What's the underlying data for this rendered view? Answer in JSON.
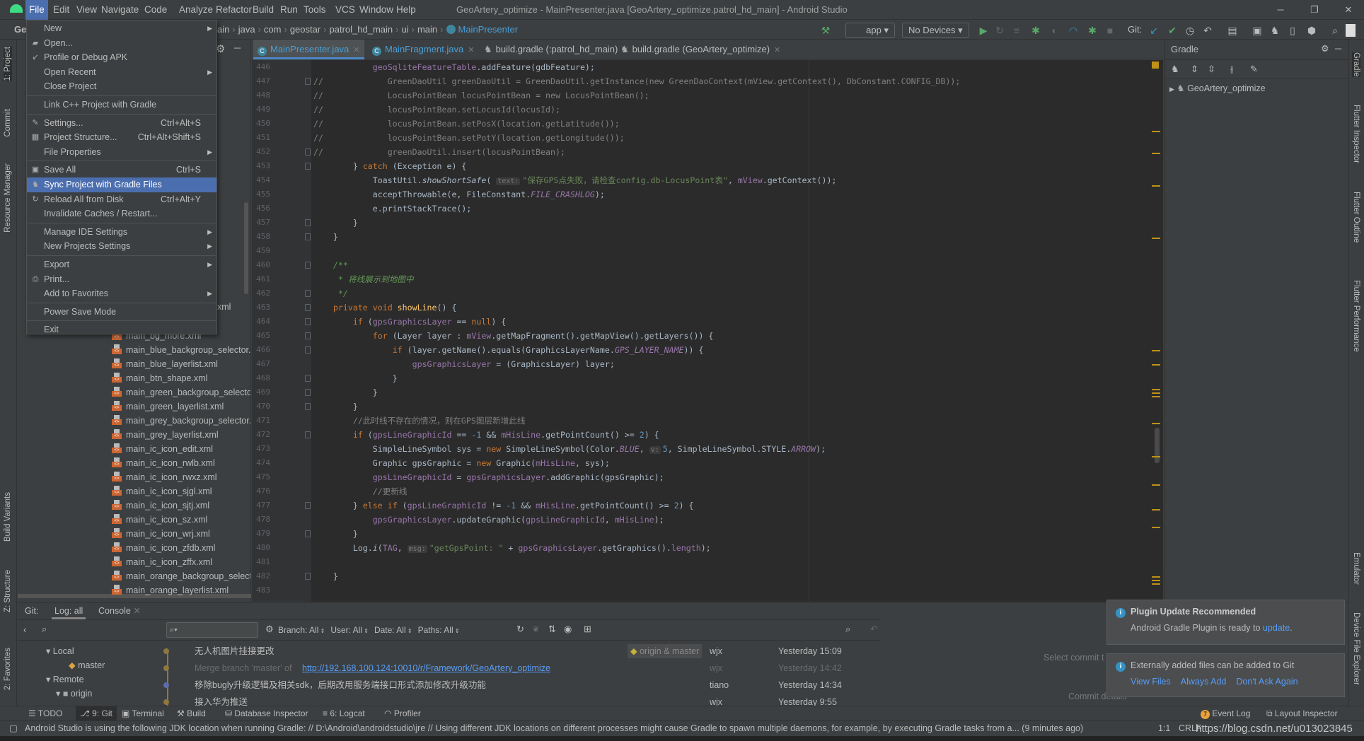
{
  "title": "GeoArtery_optimize - MainPresenter.java [GeoArtery_optimize.patrol_hd_main] - Android Studio",
  "menubar": [
    "File",
    "Edit",
    "View",
    "Navigate",
    "Code",
    "Analyze",
    "Refactor",
    "Build",
    "Run",
    "Tools",
    "VCS",
    "Window",
    "Help"
  ],
  "breadcrumb": {
    "project": "Ge",
    "items": [
      "ain",
      "java",
      "com",
      "geostar",
      "patrol_hd_main",
      "ui",
      "main"
    ],
    "current": "MainPresenter"
  },
  "toolbar": {
    "run_config": "app",
    "device": "No Devices",
    "git_label": "Git:"
  },
  "file_menu": [
    {
      "label": "New",
      "submenu": true,
      "icon": ""
    },
    {
      "label": "Open...",
      "icon": "folder-icon"
    },
    {
      "label": "Profile or Debug APK",
      "icon": "profile-icon"
    },
    {
      "label": "Open Recent",
      "submenu": true
    },
    {
      "label": "Close Project",
      "sep_after": true
    },
    {
      "label": "Link C++ Project with Gradle",
      "sep_after": true
    },
    {
      "label": "Settings...",
      "shortcut": "Ctrl+Alt+S",
      "icon": "wrench-icon"
    },
    {
      "label": "Project Structure...",
      "shortcut": "Ctrl+Alt+Shift+S",
      "icon": "project-structure-icon"
    },
    {
      "label": "File Properties",
      "submenu": true,
      "sep_after": true
    },
    {
      "label": "Save All",
      "shortcut": "Ctrl+S",
      "icon": "save-icon"
    },
    {
      "label": "Sync Project with Gradle Files",
      "icon": "gradle-sync-icon",
      "selected": true
    },
    {
      "label": "Reload All from Disk",
      "shortcut": "Ctrl+Alt+Y",
      "icon": "reload-icon"
    },
    {
      "label": "Invalidate Caches / Restart...",
      "sep_after": true
    },
    {
      "label": "Manage IDE Settings",
      "submenu": true
    },
    {
      "label": "New Projects Settings",
      "submenu": true,
      "sep_after": true
    },
    {
      "label": "Export",
      "submenu": true
    },
    {
      "label": "Print...",
      "icon": "print-icon"
    },
    {
      "label": "Add to Favorites",
      "submenu": true,
      "sep_after": true
    },
    {
      "label": "Power Save Mode",
      "sep_after": true
    },
    {
      "label": "Exit"
    }
  ],
  "left_stripe": [
    "1: Project",
    "Commit",
    "Resource Manager",
    "Build Variants",
    "Z: Structure",
    "2: Favorites"
  ],
  "right_stripe": [
    "Gradle",
    "Flutter Inspector",
    "Flutter Outline",
    "Flutter Performance",
    "Emulator",
    "Device File Explorer"
  ],
  "project_tree": {
    "partial": "xml",
    "files": [
      "main_bg_more.xml",
      "main_blue_backgroup_selector.xml",
      "main_blue_layerlist.xml",
      "main_btn_shape.xml",
      "main_green_backgroup_selector.xml",
      "main_green_layerlist.xml",
      "main_grey_backgroup_selector.xml",
      "main_grey_layerlist.xml",
      "main_ic_icon_edit.xml",
      "main_ic_icon_rwlb.xml",
      "main_ic_icon_rwxz.xml",
      "main_ic_icon_sjgl.xml",
      "main_ic_icon_sjtj.xml",
      "main_ic_icon_sz.xml",
      "main_ic_icon_wrj.xml",
      "main_ic_icon_zfdb.xml",
      "main_ic_icon_zffx.xml",
      "main_orange_backgroup_selector.xml",
      "main_orange_layerlist.xml"
    ]
  },
  "editor_tabs": [
    {
      "label": "MainPresenter.java",
      "active": true,
      "icon": "class-icon"
    },
    {
      "label": "MainFragment.java",
      "icon": "class-icon"
    },
    {
      "label": "build.gradle (:patrol_hd_main)",
      "icon": "gradle-icon"
    },
    {
      "label": "build.gradle (GeoArtery_optimize)",
      "icon": "gradle-icon"
    }
  ],
  "code": {
    "first_line": 446,
    "lines": [
      [
        [
          "            ",
          "d"
        ],
        [
          "geoSqliteFeatureTable",
          "f"
        ],
        [
          ".addFeature(gdbFeature);",
          "d"
        ]
      ],
      [
        [
          "//             GreenDaoUtil greenDaoUtil = GreenDaoUtil.getInstance(new GreenDaoContext(mView.getContext(), DbConstant.CONFIG_DB));",
          "c"
        ]
      ],
      [
        [
          "//             LocusPointBean locusPointBean = new LocusPointBean();",
          "c"
        ]
      ],
      [
        [
          "//             locusPointBean.setLocusId(locusId);",
          "c"
        ]
      ],
      [
        [
          "//             locusPointBean.setPosX(location.getLatitude());",
          "c"
        ]
      ],
      [
        [
          "//             locusPointBean.setPotY(location.getLongitude());",
          "c"
        ]
      ],
      [
        [
          "//             greenDaoUtil.insert(locusPointBean);",
          "c"
        ]
      ],
      [
        [
          "        } ",
          "d"
        ],
        [
          "catch",
          "k"
        ],
        [
          " (Exception e) {",
          "d"
        ]
      ],
      [
        [
          "            ToastUtil.",
          "d"
        ],
        [
          "showShortSafe",
          "i"
        ],
        [
          "( ",
          "d"
        ],
        [
          "text:",
          "h"
        ],
        [
          "\"保存GPS点失败，请检查config.db-LocusPoint表\"",
          "s"
        ],
        [
          ", ",
          "d"
        ],
        [
          "mView",
          "f"
        ],
        [
          ".getContext());",
          "d"
        ]
      ],
      [
        [
          "            acceptThrowable(e, FileConstant.",
          "d"
        ],
        [
          "FILE_CRASHLOG",
          "fi"
        ],
        [
          ");",
          "d"
        ]
      ],
      [
        [
          "            e.printStackTrace();",
          "d"
        ]
      ],
      [
        [
          "        }",
          "d"
        ]
      ],
      [
        [
          "    }",
          "d"
        ]
      ],
      [],
      [
        [
          "    /**",
          "doc"
        ]
      ],
      [
        [
          "     * 将线展示到地图中",
          "doc"
        ]
      ],
      [
        [
          "     */",
          "doc"
        ]
      ],
      [
        [
          "    ",
          "d"
        ],
        [
          "private void ",
          "k"
        ],
        [
          "showLine",
          "m"
        ],
        [
          "() {",
          "d"
        ]
      ],
      [
        [
          "        ",
          "d"
        ],
        [
          "if ",
          "k"
        ],
        [
          "(",
          "d"
        ],
        [
          "gpsGraphicsLayer",
          "f"
        ],
        [
          " == ",
          "d"
        ],
        [
          "null",
          "k"
        ],
        [
          ") {",
          "d"
        ]
      ],
      [
        [
          "            ",
          "d"
        ],
        [
          "for ",
          "k"
        ],
        [
          "(Layer layer : ",
          "d"
        ],
        [
          "mView",
          "f"
        ],
        [
          ".getMapFragment().getMapView().getLayers()) {",
          "d"
        ]
      ],
      [
        [
          "                ",
          "d"
        ],
        [
          "if ",
          "k"
        ],
        [
          "(layer.getName().equals(GraphicsLayerName.",
          "d"
        ],
        [
          "GPS_LAYER_NAME",
          "fi"
        ],
        [
          ")) {",
          "d"
        ]
      ],
      [
        [
          "                    ",
          "d"
        ],
        [
          "gpsGraphicsLayer",
          "f"
        ],
        [
          " = (GraphicsLayer) layer;",
          "d"
        ]
      ],
      [
        [
          "                }",
          "d"
        ]
      ],
      [
        [
          "            }",
          "d"
        ]
      ],
      [
        [
          "        }",
          "d"
        ]
      ],
      [
        [
          "        ",
          "d"
        ],
        [
          "//此时线不存在的情况，则在GPS图层新增此线",
          "c"
        ]
      ],
      [
        [
          "        ",
          "d"
        ],
        [
          "if ",
          "k"
        ],
        [
          "(",
          "d"
        ],
        [
          "gpsLineGraphicId",
          "f"
        ],
        [
          " == ",
          "d"
        ],
        [
          "-1",
          "n"
        ],
        [
          " && ",
          "d"
        ],
        [
          "mHisLine",
          "f"
        ],
        [
          ".getPointCount() >= ",
          "d"
        ],
        [
          "2",
          "n"
        ],
        [
          ") {",
          "d"
        ]
      ],
      [
        [
          "            SimpleLineSymbol sys = ",
          "d"
        ],
        [
          "new ",
          "k"
        ],
        [
          "SimpleLineSymbol(Color.",
          "d"
        ],
        [
          "BLUE",
          "fi"
        ],
        [
          ", ",
          "d"
        ],
        [
          "v:",
          "h"
        ],
        [
          "5",
          "n"
        ],
        [
          ", SimpleLineSymbol.STYLE.",
          "d"
        ],
        [
          "ARROW",
          "fi"
        ],
        [
          ");",
          "d"
        ]
      ],
      [
        [
          "            Graphic gpsGraphic = ",
          "d"
        ],
        [
          "new ",
          "k"
        ],
        [
          "Graphic(",
          "d"
        ],
        [
          "mHisLine",
          "f"
        ],
        [
          ", sys);",
          "d"
        ]
      ],
      [
        [
          "            ",
          "d"
        ],
        [
          "gpsLineGraphicId",
          "f"
        ],
        [
          " = ",
          "d"
        ],
        [
          "gpsGraphicsLayer",
          "f"
        ],
        [
          ".addGraphic(gpsGraphic);",
          "d"
        ]
      ],
      [
        [
          "            ",
          "d"
        ],
        [
          "//更新线",
          "c"
        ]
      ],
      [
        [
          "        } ",
          "d"
        ],
        [
          "else if ",
          "k"
        ],
        [
          "(",
          "d"
        ],
        [
          "gpsLineGraphicId",
          "f"
        ],
        [
          " != ",
          "d"
        ],
        [
          "-1",
          "n"
        ],
        [
          " && ",
          "d"
        ],
        [
          "mHisLine",
          "f"
        ],
        [
          ".getPointCount() >= ",
          "d"
        ],
        [
          "2",
          "n"
        ],
        [
          ") {",
          "d"
        ]
      ],
      [
        [
          "            ",
          "d"
        ],
        [
          "gpsGraphicsLayer",
          "f"
        ],
        [
          ".updateGraphic(",
          "d"
        ],
        [
          "gpsLineGraphicId",
          "f"
        ],
        [
          ", ",
          "d"
        ],
        [
          "mHisLine",
          "f"
        ],
        [
          ");",
          "d"
        ]
      ],
      [
        [
          "        }",
          "d"
        ]
      ],
      [
        [
          "        Log.",
          "d"
        ],
        [
          "i",
          "i"
        ],
        [
          "(",
          "d"
        ],
        [
          "TAG",
          "f"
        ],
        [
          ", ",
          "d"
        ],
        [
          "msg:",
          "h"
        ],
        [
          "\"getGpsPoint: \"",
          "s"
        ],
        [
          " + ",
          "d"
        ],
        [
          "gpsGraphicsLayer",
          "f"
        ],
        [
          ".getGraphics().",
          "d"
        ],
        [
          "length",
          "f"
        ],
        [
          ");",
          "d"
        ]
      ],
      [],
      [
        [
          "    }",
          "d"
        ]
      ],
      []
    ]
  },
  "gradle_panel": {
    "title": "Gradle",
    "root": "GeoArtery_optimize"
  },
  "bottom": {
    "tabs": {
      "prefix": "Git:",
      "log": "Log: all",
      "console": "Console"
    },
    "branches": {
      "local": "Local",
      "master": "master",
      "remote": "Remote",
      "origin": "origin"
    },
    "filters": [
      "Branch: All",
      "User: All",
      "Date: All",
      "Paths: All"
    ],
    "commits": [
      {
        "message": "无人机图片挂接更改",
        "refs": "origin & master",
        "author": "wjx",
        "date": "Yesterday 15:09"
      },
      {
        "message": "Merge branch 'master' of ",
        "link": "http://192.168.100.124:10010/r/Framework/GeoArtery_optimize",
        "author": "wjx",
        "date": "Yesterday 14:42",
        "dim": true
      },
      {
        "message": "移除bugly升级逻辑及相关sdk，后期改用服务端接口形式添加修改升级功能",
        "author": "tiano",
        "date": "Yesterday 14:34"
      },
      {
        "message": "接入华为推送",
        "author": "wjx",
        "date": "Yesterday 9:55"
      }
    ],
    "select_commit": "Select commit t",
    "commit_details": "Commit details"
  },
  "notifications": [
    {
      "title": "Plugin Update Recommended",
      "text": "Android Gradle Plugin is ready to ",
      "link": "update",
      "after": "."
    },
    {
      "text": "Externally added files can be added to Git",
      "actions": [
        "View Files",
        "Always Add",
        "Don't Ask Again"
      ]
    }
  ],
  "tool_windows": [
    "TODO",
    "9: Git",
    "Terminal",
    "Build",
    "Database Inspector",
    "6: Logcat",
    "Profiler"
  ],
  "tool_windows_right": {
    "event_log_count": "7",
    "event_log": "Event Log",
    "layout_inspector": "Layout Inspector"
  },
  "status": {
    "message": "Android Studio is using the following JDK location when running Gradle: // D:\\Android\\androidstudio\\jre // Using different JDK locations on different processes might cause Gradle to spawn multiple daemons, for example, by executing Gradle tasks from a... (9 minutes ago)",
    "position": "1:1",
    "line_sep": "CRLF"
  },
  "watermark": "https://blog.csdn.net/u013023845",
  "colors": {
    "accent": "#4b6eaf",
    "editor_bg": "#2b2b2b",
    "panel_bg": "#3c3f41",
    "keyword": "#cc7832",
    "field": "#9876aa",
    "string": "#6a8759"
  }
}
